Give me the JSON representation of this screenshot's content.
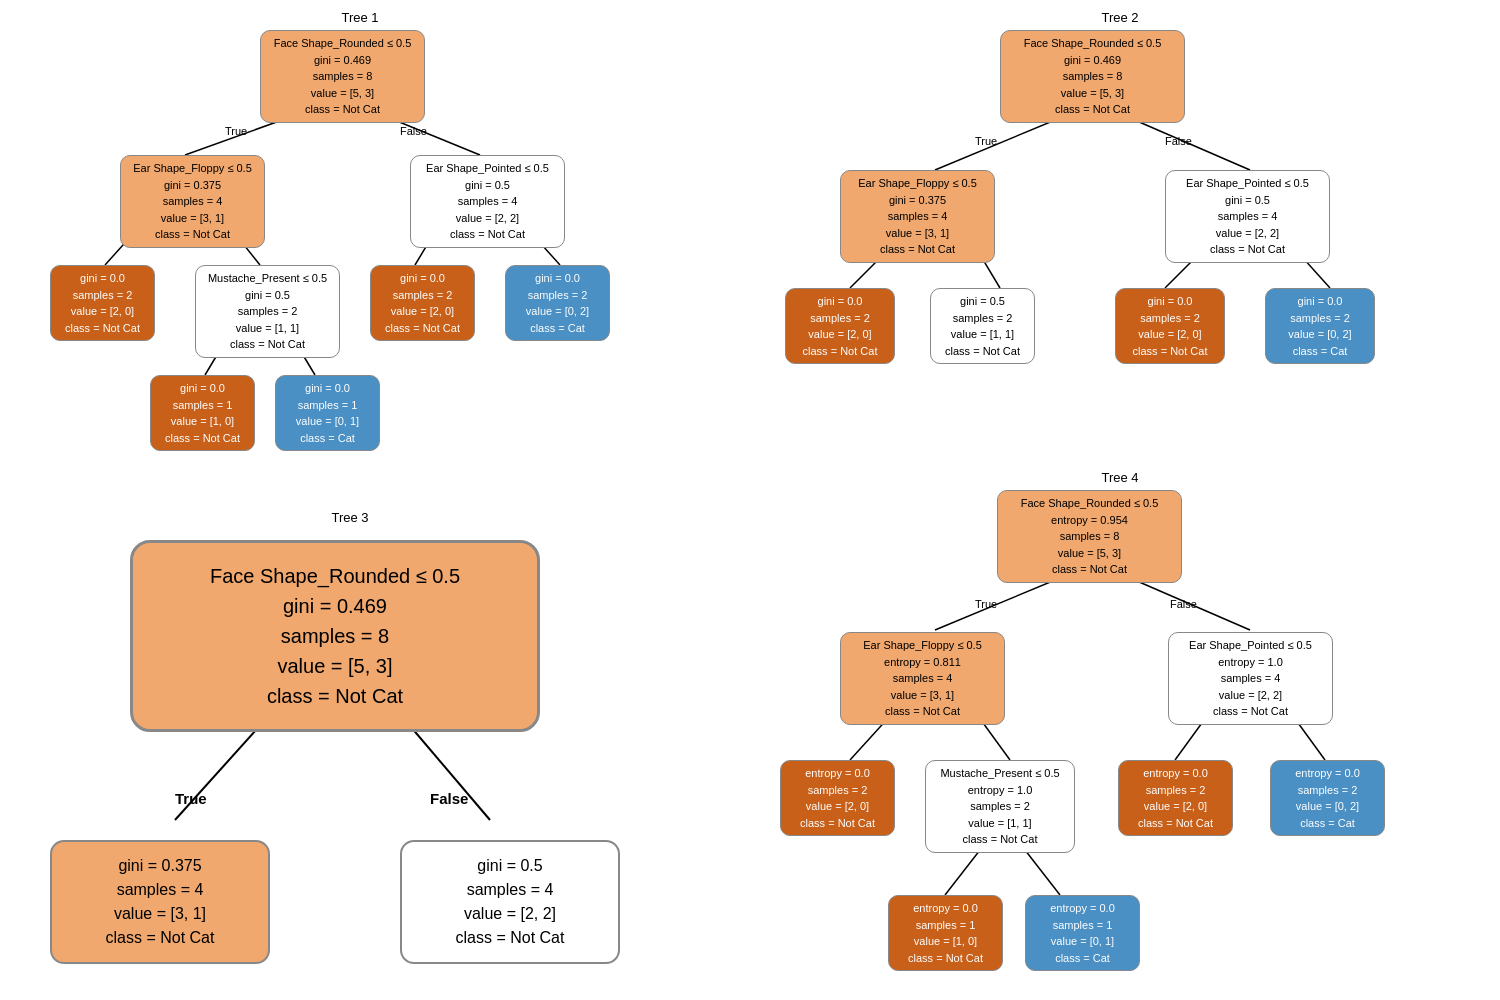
{
  "trees": {
    "tree1": {
      "title": "Tree 1",
      "nodes": {
        "root": {
          "text": "Face Shape_Rounded ≤ 0.5\ngini = 0.469\nsamples = 8\nvalue = [5, 3]\nclass = Not Cat",
          "color": "orange-light"
        },
        "left1": {
          "text": "Ear Shape_Floppy ≤ 0.5\ngini = 0.375\nsamples = 4\nvalue = [3, 1]\nclass = Not Cat",
          "color": "orange-light"
        },
        "right1": {
          "text": "Ear Shape_Pointed ≤ 0.5\ngini = 0.5\nsamples = 4\nvalue = [2, 2]\nclass = Not Cat",
          "color": "white"
        },
        "ll": {
          "text": "gini = 0.0\nsamples = 2\nvalue = [2, 0]\nclass = Not Cat",
          "color": "orange-dark"
        },
        "lm": {
          "text": "Mustache_Present ≤ 0.5\ngini = 0.5\nsamples = 2\nvalue = [1, 1]\nclass = Not Cat",
          "color": "white"
        },
        "rl": {
          "text": "gini = 0.0\nsamples = 2\nvalue = [2, 0]\nclass = Not Cat",
          "color": "orange-dark"
        },
        "rr": {
          "text": "gini = 0.0\nsamples = 2\nvalue = [0, 2]\nclass = Cat",
          "color": "blue"
        },
        "lml": {
          "text": "gini = 0.0\nsamples = 1\nvalue = [1, 0]\nclass = Not Cat",
          "color": "orange-dark"
        },
        "lmr": {
          "text": "gini = 0.0\nsamples = 1\nvalue = [0, 1]\nclass = Cat",
          "color": "blue"
        }
      }
    },
    "tree2": {
      "title": "Tree 2"
    },
    "tree3": {
      "title": "Tree 3"
    },
    "tree4": {
      "title": "Tree 4"
    }
  },
  "labels": {
    "true": "True",
    "false": "False"
  }
}
